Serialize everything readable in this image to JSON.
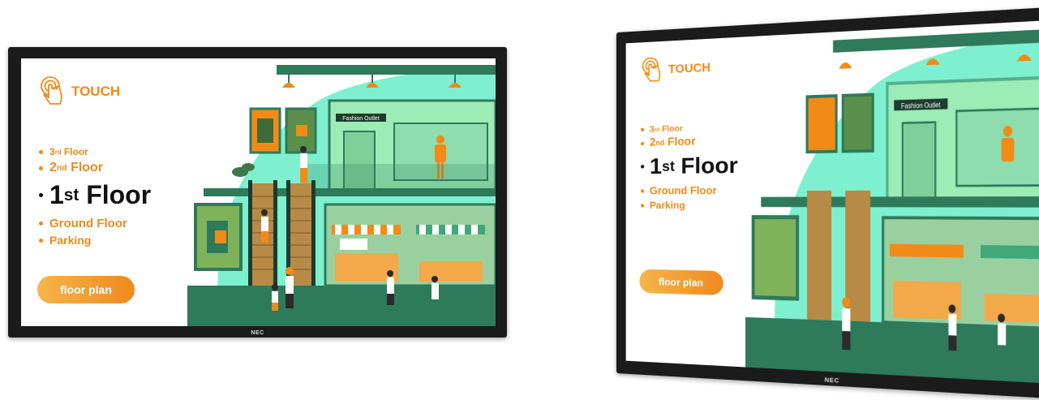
{
  "kiosk": {
    "touch_label": "TOUCH",
    "floors": [
      {
        "num": "3",
        "suffix": "rd",
        "word": "Floor"
      },
      {
        "num": "2",
        "suffix": "nd",
        "word": "Floor"
      },
      {
        "num": "1",
        "suffix": "st",
        "word": "Floor"
      },
      {
        "label": "Ground Floor"
      },
      {
        "label": "Parking"
      }
    ],
    "selected_floor": "1st Floor",
    "floor_plan_button": "floor plan",
    "shop_sign": "Fashion Outlet",
    "brand": "NEC"
  },
  "colors": {
    "accent": "#f28a17",
    "mint": "#7ff0cf",
    "teal": "#2e7a5a",
    "frame": "#1b1b1b"
  }
}
